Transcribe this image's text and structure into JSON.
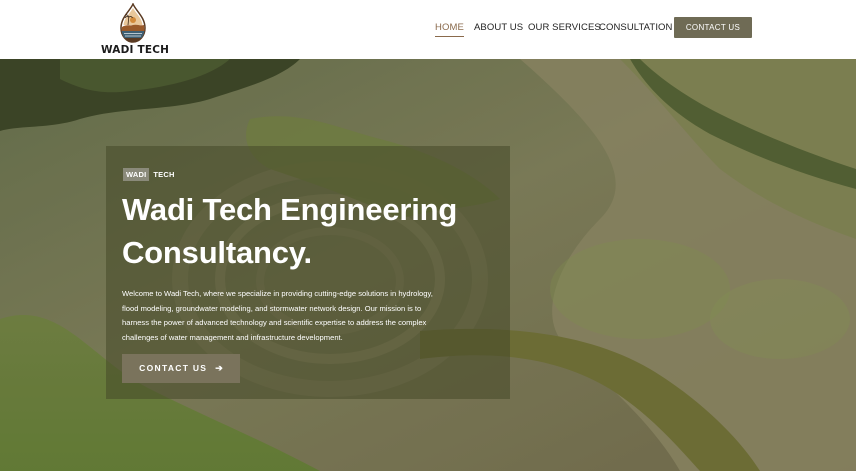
{
  "brand": {
    "name": "WADI TECH"
  },
  "nav": {
    "items": [
      {
        "label": "HOME",
        "active": true
      },
      {
        "label": "ABOUT US",
        "active": false
      },
      {
        "label": "OUR SERVICES",
        "active": false
      },
      {
        "label": "CONSULTATION",
        "active": false
      }
    ],
    "contact_label": "CONTACT US"
  },
  "hero": {
    "badge_primary": "WADI",
    "badge_secondary": "TECH",
    "title": "Wadi Tech Engineering Consultancy.",
    "description": "Welcome to Wadi Tech, where we specialize in providing cutting-edge solutions in hydrology, flood modeling, groundwater modeling, and stormwater network design. Our mission is to harness the power of advanced technology and scientific expertise to address the complex challenges of water management and infrastructure development.",
    "cta_label": "CONTACT US",
    "cta_icon": "arrow-right-icon"
  },
  "colors": {
    "accent": "#8a6a4c",
    "button": "#6f6b55",
    "cta": "#7a735c",
    "card_overlay": "#46482899"
  }
}
